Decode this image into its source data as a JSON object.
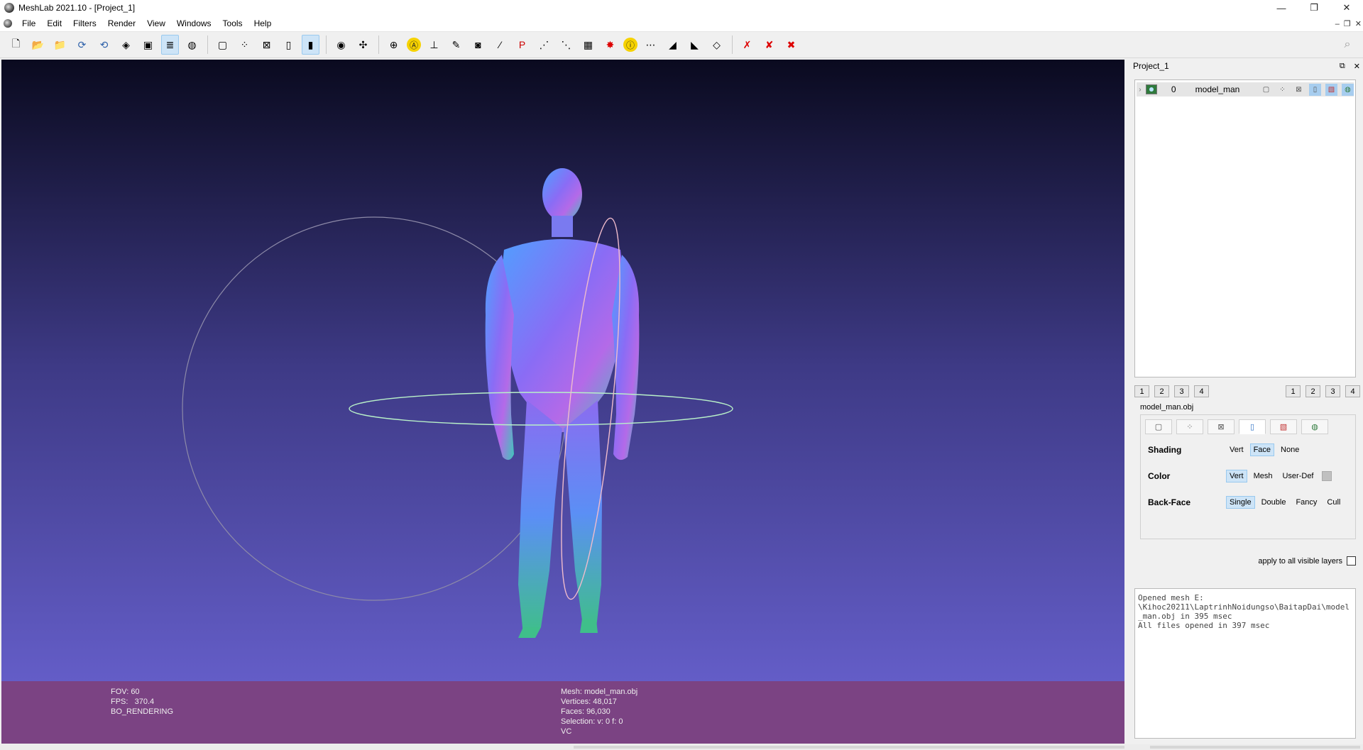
{
  "window": {
    "title": "MeshLab 2021.10 - [Project_1]",
    "controls": {
      "minimize": "—",
      "restore": "❐",
      "close": "✕"
    },
    "mdi_controls": {
      "minimize": "‒",
      "restore": "❐",
      "close": "✕"
    }
  },
  "menubar": {
    "items": [
      "File",
      "Edit",
      "Filters",
      "Render",
      "View",
      "Windows",
      "Tools",
      "Help"
    ]
  },
  "toolbar": {
    "groups": [
      [
        "new-project-icon",
        "open-project-icon",
        "open-mesh-icon",
        "reload-icon",
        "reload-all-icon",
        "save-icon",
        "snapshot-icon",
        "layers-icon",
        "raster-icon"
      ],
      [
        "bbox-icon",
        "points-icon",
        "wireframe-icon",
        "flat-icon",
        "smooth-icon"
      ],
      [
        "light-icon",
        "trackball-icon"
      ],
      [
        "measure-icon",
        "annotation-icon",
        "align-icon",
        "paint-icon",
        "camera-icon",
        "brush-icon",
        "pick-icon",
        "select-icon",
        "select-vert-icon",
        "texture-icon",
        "georef-icon",
        "info-icon",
        "select-faces-icon",
        "select-connected-icon",
        "select-conn-2-icon",
        "select-deselect-icon"
      ],
      [
        "delete-faces-icon",
        "delete-verts-icon",
        "delete-all-icon"
      ]
    ],
    "glyphs": {
      "new-project-icon": "🗋",
      "open-project-icon": "📂",
      "open-mesh-icon": "📁",
      "reload-icon": "⟳",
      "reload-all-icon": "⟲",
      "save-icon": "◈",
      "snapshot-icon": "▣",
      "layers-icon": "≣",
      "raster-icon": "◍",
      "bbox-icon": "▢",
      "points-icon": "⁘",
      "wireframe-icon": "⊠",
      "flat-icon": "▯",
      "smooth-icon": "▮",
      "light-icon": "◉",
      "trackball-icon": "✣",
      "measure-icon": "⊕",
      "annotation-icon": "Ⓐ",
      "align-icon": "⊥",
      "paint-icon": "✎",
      "camera-icon": "◙",
      "brush-icon": "⁄",
      "pick-icon": "P",
      "select-icon": "⋰",
      "select-vert-icon": "⋱",
      "texture-icon": "▦",
      "georef-icon": "✸",
      "info-icon": "ⓘ",
      "select-faces-icon": "⋯",
      "select-connected-icon": "◢",
      "select-conn-2-icon": "◣",
      "select-deselect-icon": "◇",
      "delete-faces-icon": "✗",
      "delete-verts-icon": "✘",
      "delete-all-icon": "✖"
    },
    "active": [
      "layers-icon",
      "smooth-icon"
    ],
    "search_icon": "⌕"
  },
  "viewport": {
    "info_left": [
      "FOV: 60",
      "FPS:   370.4",
      "BO_RENDERING"
    ],
    "info_mid": [
      "Mesh: model_man.obj",
      "Vertices: 48,017",
      "Faces: 96,030",
      "Selection: v: 0 f: 0",
      "VC"
    ]
  },
  "panel": {
    "title": "Project_1",
    "header_buttons": {
      "float": "⧉",
      "close": "✕"
    },
    "layer": {
      "expander": "›",
      "id": "0",
      "name": "model_man"
    },
    "left_numbers": [
      "1",
      "2",
      "3",
      "4"
    ],
    "right_numbers": [
      "1",
      "2",
      "3",
      "4"
    ],
    "mesh_file": "model_man.obj",
    "render_tabs": [
      "bbox",
      "points",
      "wire",
      "fill",
      "texture",
      "extra"
    ],
    "render_tab_glyphs": [
      "▢",
      "⁘",
      "⊠",
      "▯",
      "▧",
      "◍"
    ],
    "shading": {
      "label": "Shading",
      "options": [
        "Vert",
        "Face",
        "None"
      ],
      "selected": "Face"
    },
    "color": {
      "label": "Color",
      "options": [
        "Vert",
        "Mesh",
        "User-Def"
      ],
      "selected": "Vert"
    },
    "backface": {
      "label": "Back-Face",
      "options": [
        "Single",
        "Double",
        "Fancy",
        "Cull"
      ],
      "selected": "Single"
    },
    "apply_all": "apply to all visible layers",
    "log": "Opened mesh E:\n\\Kihoc20211\\LaptrinhNoidungso\\BaitapDai\\model_man.obj in 395 msec\nAll files opened in 397 msec"
  }
}
